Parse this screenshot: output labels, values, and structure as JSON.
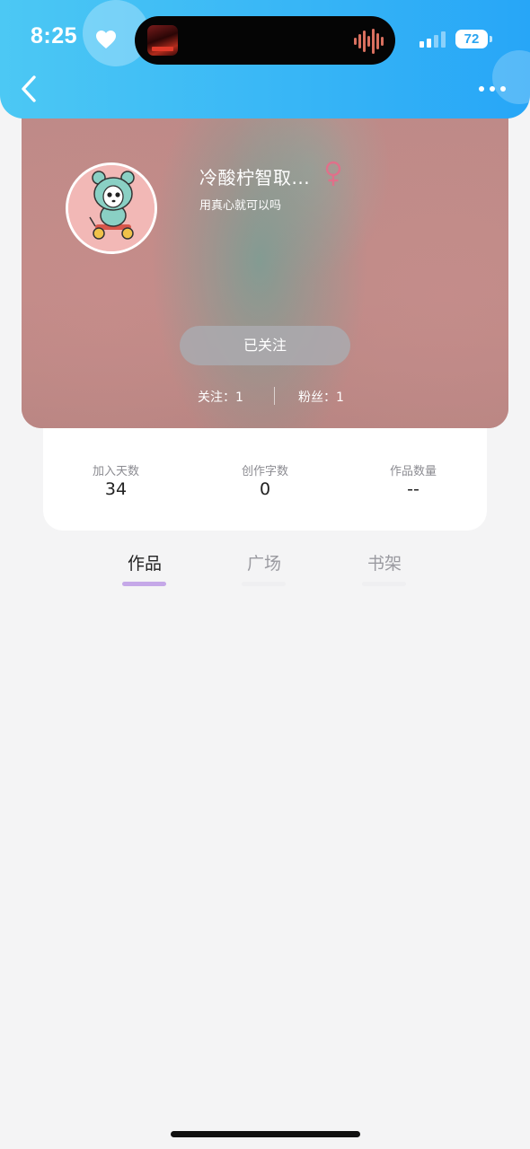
{
  "status_bar": {
    "time": "8:25",
    "battery": "72",
    "icons": [
      "heart-icon",
      "music-waveform-icon",
      "cellular-signal-icon",
      "battery-icon"
    ]
  },
  "nav": {
    "icons": [
      "back-chevron-icon",
      "more-dots-icon"
    ]
  },
  "profile": {
    "nickname": "冷酸柠智取...",
    "bio": "用真心就可以吗",
    "gender_icon": "female-icon",
    "follow_button": "已关注",
    "following_text": "关注：1",
    "fans_text": "粉丝：1"
  },
  "stats": [
    {
      "label": "加入天数",
      "value": "34"
    },
    {
      "label": "创作字数",
      "value": "0"
    },
    {
      "label": "作品数量",
      "value": "--"
    }
  ],
  "tabs": [
    {
      "label": "作品",
      "active": true
    },
    {
      "label": "广场",
      "active": false
    },
    {
      "label": "书架",
      "active": false
    }
  ],
  "colors": {
    "header_blue": "#38b6f6",
    "card_tint": "#c18a88",
    "tab_active_bar": "#c5a8e8",
    "gender_pink": "#e0708a"
  }
}
